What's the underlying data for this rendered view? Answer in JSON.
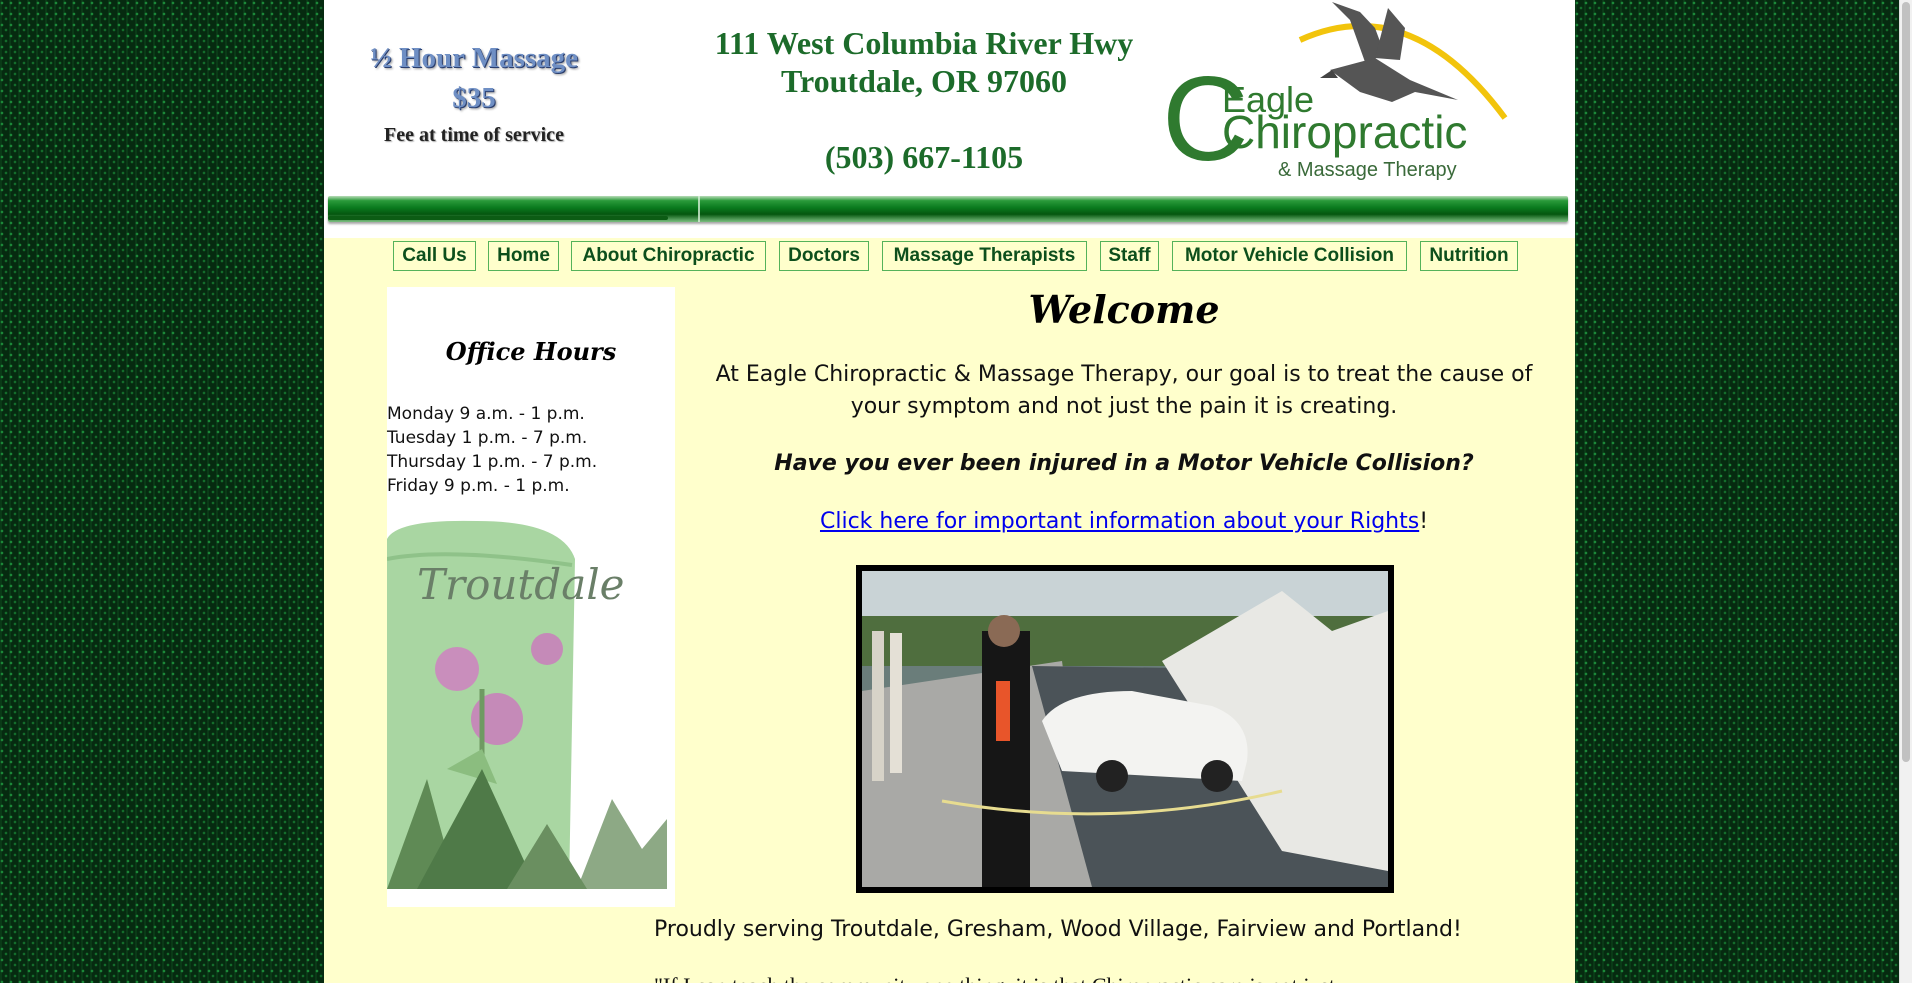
{
  "header": {
    "promo": {
      "line1": "½  Hour Massage",
      "line2": "$35",
      "line3": "Fee at time of service"
    },
    "address": {
      "street": "111 West Columbia River Hwy",
      "city": "Troutdale, OR 97060",
      "phone": "(503) 667-1105"
    },
    "logo": {
      "line1": "Eagle",
      "line2": "Chiropractic",
      "line3": "& Massage Therapy"
    }
  },
  "nav": {
    "items": [
      {
        "label": "Call Us"
      },
      {
        "label": "Home"
      },
      {
        "label": "About Chiropractic"
      },
      {
        "label": "Doctors"
      },
      {
        "label": "Massage Therapists"
      },
      {
        "label": "Staff"
      },
      {
        "label": "Motor Vehicle Collision"
      },
      {
        "label": "Nutrition"
      }
    ]
  },
  "sidebar": {
    "title": "Office Hours",
    "hours": [
      "Monday 9 a.m. - 1 p.m.",
      "Tuesday 1 p.m. - 7 p.m.",
      "Thursday 1 p.m. - 7 p.m.",
      "Friday 9 p.m. - 1 p.m."
    ],
    "tower_text": "Troutdale"
  },
  "main": {
    "heading": "Welcome",
    "intro": "At Eagle Chiropractic & Massage Therapy, our goal is to treat the cause of your symptom and not just the pain it is creating.",
    "question": "Have you ever been injured in a Motor Vehicle Collision?",
    "rights_link": "Click here for important information about your Rights",
    "rights_suffix": "!",
    "serving": "Proudly serving Troutdale, Gresham, Wood Village, Fairview and Portland!",
    "quote": "\"If I can teach the community one thing, it is that Chiropractic care is not just"
  },
  "colors": {
    "page_bg": "#ffffcc",
    "nav_text": "#0d4f1c",
    "header_green": "#1c6b2a",
    "link": "#0000ee"
  }
}
